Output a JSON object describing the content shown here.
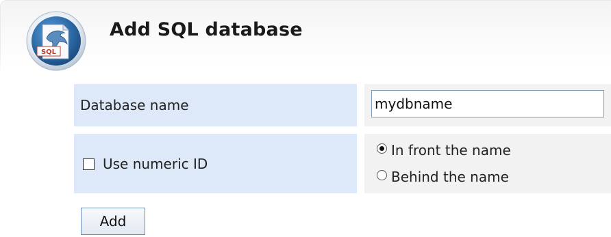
{
  "header": {
    "title": "Add SQL database",
    "logo_text": "SQL"
  },
  "form": {
    "database_name": {
      "label": "Database name",
      "value": "mydbname"
    },
    "numeric_id": {
      "checkbox_label": "Use numeric ID",
      "checked": false,
      "options": [
        {
          "label": "In front the name",
          "selected": true
        },
        {
          "label": "Behind the name",
          "selected": false
        }
      ]
    },
    "submit_label": "Add"
  },
  "colors": {
    "label_cell_bg": "#dde9f8",
    "value_cell_bg": "#f2f2f2",
    "input_border": "#7f9db9",
    "button_border": "#6f8fb8",
    "logo_blue": "#2d6aa5"
  }
}
